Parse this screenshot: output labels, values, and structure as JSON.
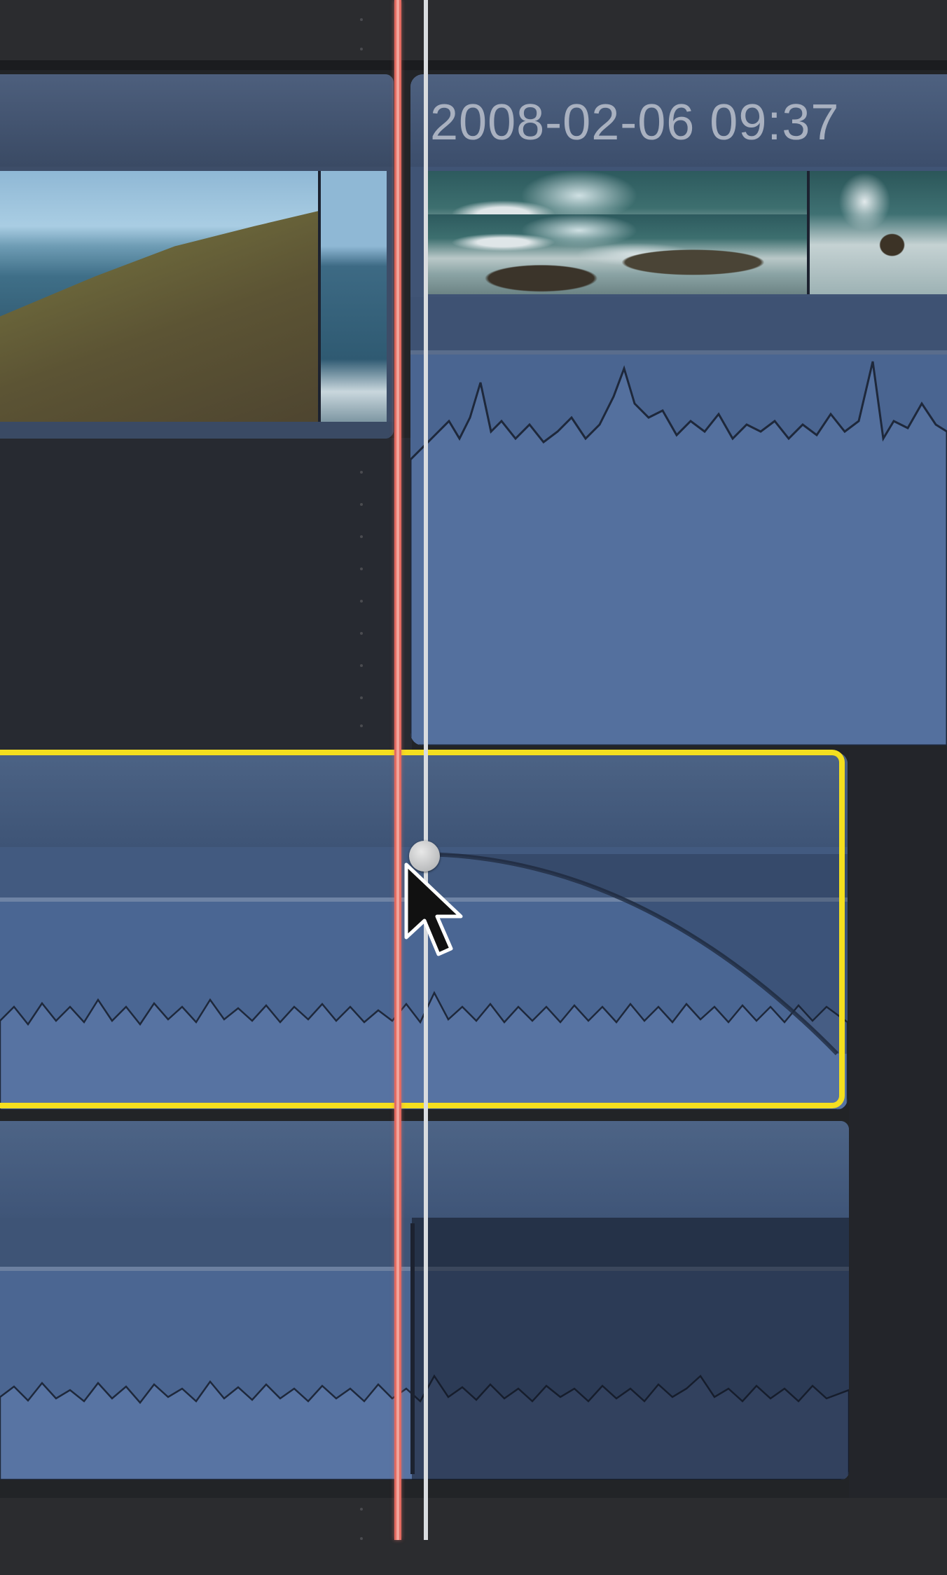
{
  "timeline": {
    "clips": [
      {
        "id": "clip-a",
        "type": "video",
        "title": "",
        "selected": false
      },
      {
        "id": "clip-b",
        "type": "video",
        "title": "2008-02-06 09:37",
        "selected": false
      },
      {
        "id": "clip-c",
        "type": "audio",
        "title": "",
        "selected": true
      },
      {
        "id": "clip-d",
        "type": "audio",
        "title": "",
        "selected": false
      }
    ],
    "selection_color": "#f4df1f",
    "playhead_color": "#e36b61",
    "skimmer_color": "#d9dcdf",
    "audio_color": "#4a6591"
  },
  "icons": {
    "cursor": "arrow-pointer-icon",
    "fade_handle": "fade-handle-icon"
  }
}
